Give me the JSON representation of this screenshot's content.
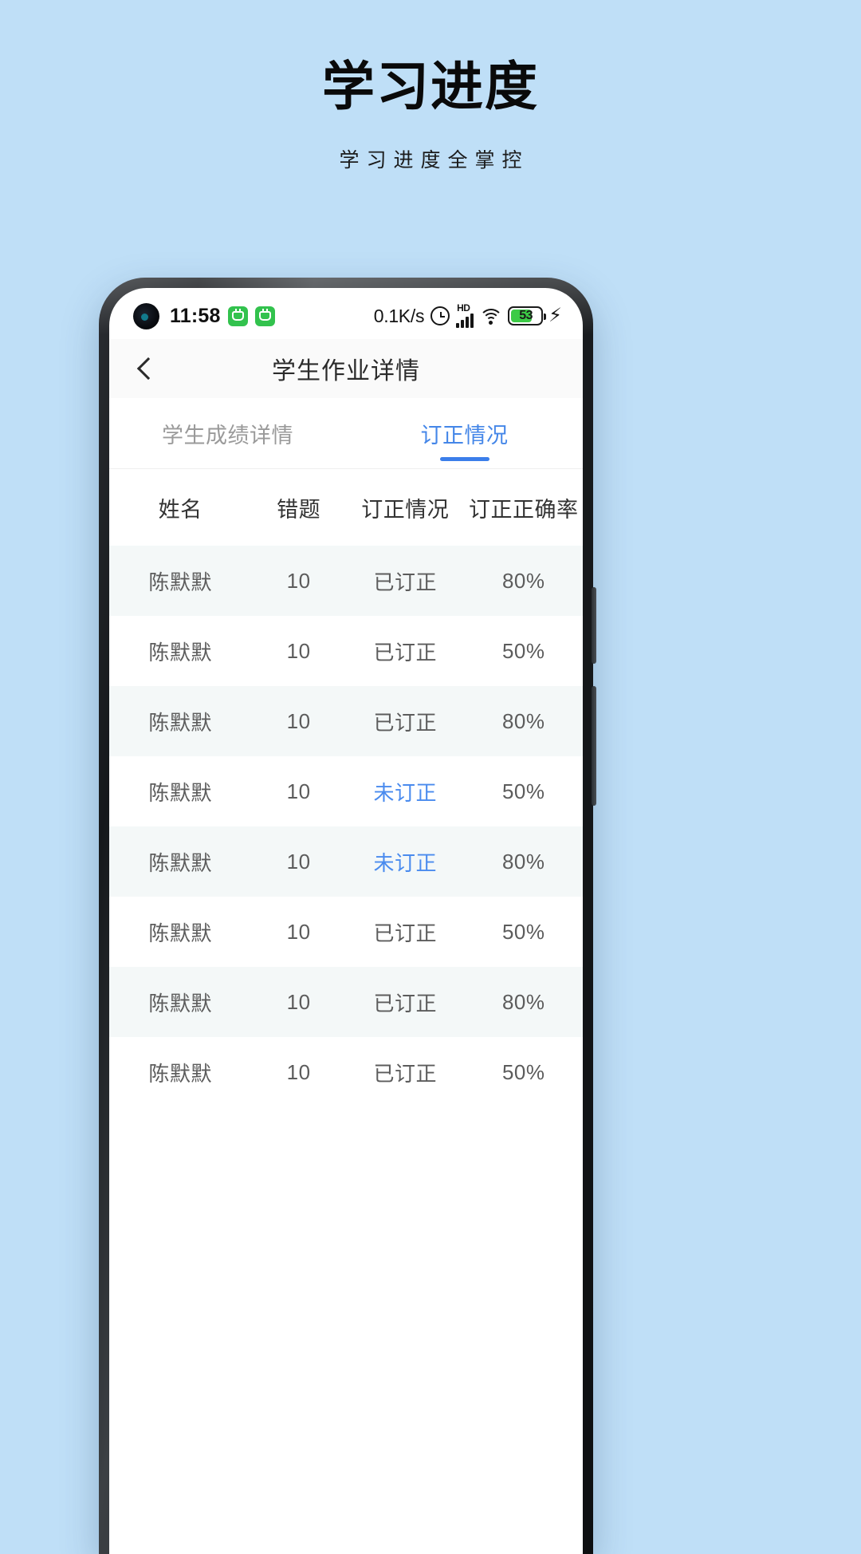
{
  "promo": {
    "title": "学习进度",
    "subtitle": "学习进度全掌控",
    "background_color": "#bfdff7"
  },
  "status_bar": {
    "time": "11:58",
    "network_speed": "0.1K/s",
    "alarm_icon": "alarm-clock-icon",
    "hd_label": "HD",
    "signal_icon": "cellular-signal-icon",
    "wifi_icon": "wifi-icon",
    "battery_level": "53",
    "charging_icon": "lightning-bolt-icon",
    "app_badges": [
      "app-badge-icon",
      "app-badge-icon"
    ]
  },
  "nav_bar": {
    "back_icon": "back-chevron-icon",
    "title": "学生作业详情"
  },
  "tabs": [
    {
      "label": "学生成绩详情",
      "active": false
    },
    {
      "label": "订正情况",
      "active": true
    }
  ],
  "accent_color": "#3b7eea",
  "table": {
    "headers": [
      "姓名",
      "错题",
      "订正情况",
      "订正正确率"
    ],
    "rows": [
      {
        "name": "陈默默",
        "wrong": "10",
        "state": "已订正",
        "pending": false,
        "rate": "80%"
      },
      {
        "name": "陈默默",
        "wrong": "10",
        "state": "已订正",
        "pending": false,
        "rate": "50%"
      },
      {
        "name": "陈默默",
        "wrong": "10",
        "state": "已订正",
        "pending": false,
        "rate": "80%"
      },
      {
        "name": "陈默默",
        "wrong": "10",
        "state": "未订正",
        "pending": true,
        "rate": "50%"
      },
      {
        "name": "陈默默",
        "wrong": "10",
        "state": "未订正",
        "pending": true,
        "rate": "80%"
      },
      {
        "name": "陈默默",
        "wrong": "10",
        "state": "已订正",
        "pending": false,
        "rate": "50%"
      },
      {
        "name": "陈默默",
        "wrong": "10",
        "state": "已订正",
        "pending": false,
        "rate": "80%"
      },
      {
        "name": "陈默默",
        "wrong": "10",
        "state": "已订正",
        "pending": false,
        "rate": "50%"
      }
    ]
  }
}
